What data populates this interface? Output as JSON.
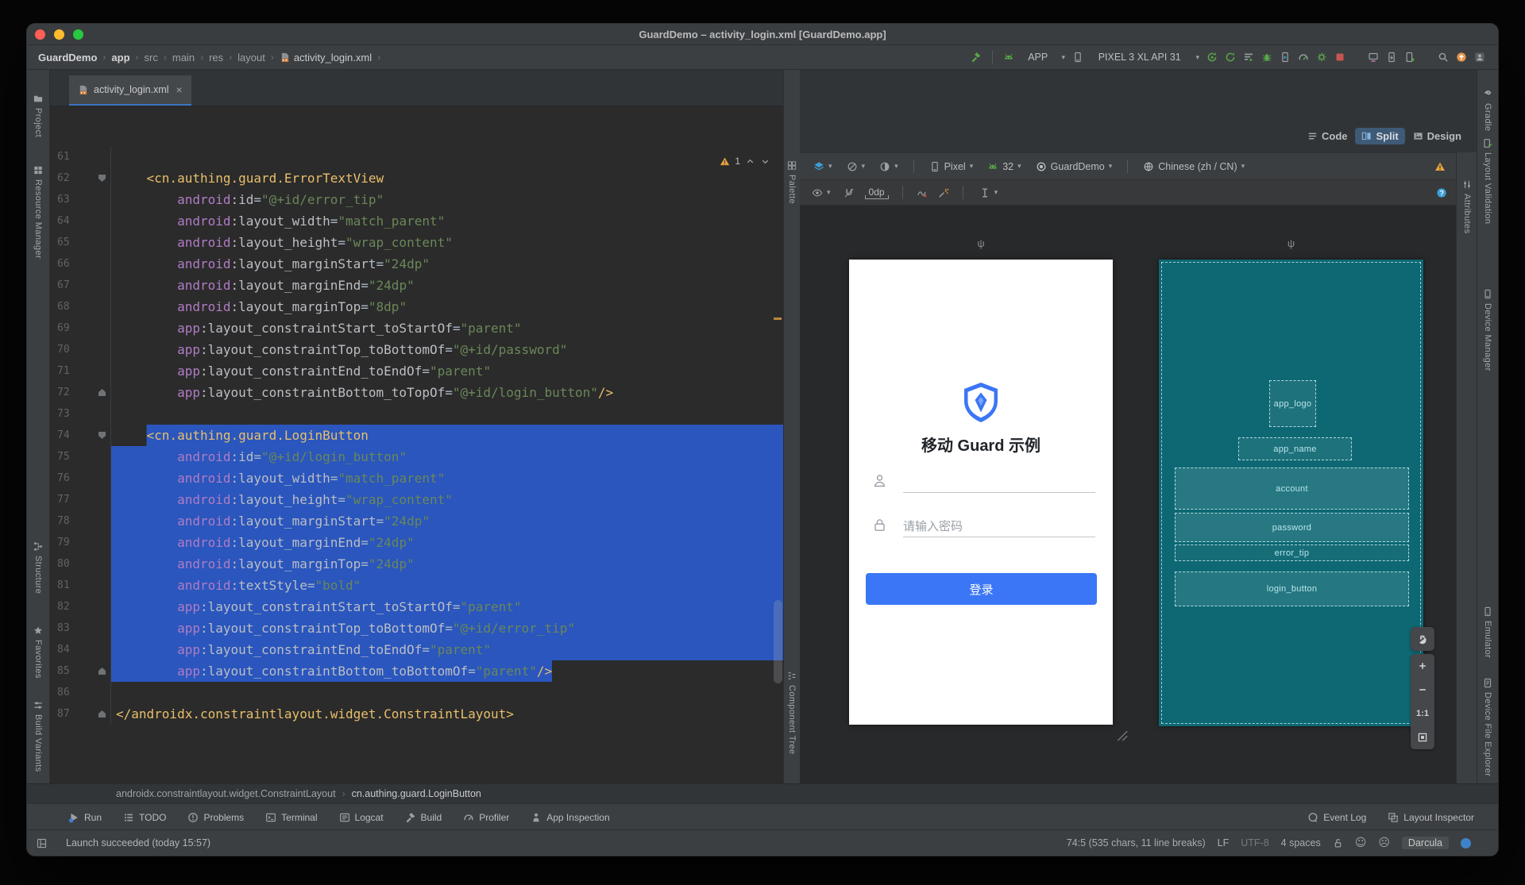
{
  "window_title": "GuardDemo – activity_login.xml [GuardDemo.app]",
  "breadcrumbs": {
    "items": [
      "GuardDemo",
      "app",
      "src",
      "main",
      "res",
      "layout",
      "activity_login.xml"
    ],
    "bold_items": [
      "GuardDemo",
      "app"
    ],
    "file_icon": "xml-file-icon"
  },
  "main_toolbar": {
    "build_icon": "hammer-icon",
    "run_config": {
      "icon": "android-head-icon",
      "label": "APP",
      "caret": "▾"
    },
    "device_select": {
      "icon": "device-phone-icon",
      "label": "PIXEL 3 XL API 31",
      "caret": "▾"
    },
    "action_icons": [
      "apply-changes-icon",
      "apply-code-changes-icon",
      "profiler-sessions-icon",
      "debug-icon",
      "attach-debugger-icon",
      "profile-app-icon",
      "coverage-icon",
      "stop-icon"
    ],
    "utility_icons": [
      "device-mirror-icon",
      "device-manager-icon",
      "virtual-device-icon"
    ],
    "end_icons": [
      "search-icon",
      "ide-update-icon",
      "avatar-icon"
    ]
  },
  "left_strip": [
    {
      "label": "Project",
      "icon": "project-icon"
    },
    {
      "label": "Resource Manager",
      "icon": "resource-manager-icon"
    },
    {
      "label": "Structure",
      "icon": "structure-icon"
    },
    {
      "label": "Favorites",
      "icon": "favorites-icon"
    },
    {
      "label": "Build Variants",
      "icon": "build-variants-icon"
    }
  ],
  "right_strip": [
    {
      "label": "Gradle",
      "icon": "gradle-icon"
    },
    {
      "label": "Layout Validation",
      "icon": "layout-validation-icon"
    },
    {
      "label": "Device Manager",
      "icon": "device-manager-strip-icon"
    },
    {
      "label": "Emulator",
      "icon": "emulator-icon"
    },
    {
      "label": "Device File Explorer",
      "icon": "device-file-explorer-icon"
    }
  ],
  "mid_strip": {
    "palette": {
      "label": "Palette",
      "icon": "palette-icon"
    },
    "component_tree": {
      "label": "Component Tree",
      "icon": "component-tree-icon"
    }
  },
  "attributes_tab": {
    "label": "Attributes",
    "icon": "attributes-icon"
  },
  "view_modes": {
    "options": [
      {
        "label": "Code",
        "icon": "code-view-icon",
        "active": false
      },
      {
        "label": "Split",
        "icon": "split-view-icon",
        "active": true
      },
      {
        "label": "Design",
        "icon": "design-view-icon",
        "active": false
      }
    ]
  },
  "editor": {
    "tab_label": "activity_login.xml",
    "warning_count": "1",
    "lines": [
      {
        "n": 61,
        "ind": 0,
        "tok": []
      },
      {
        "n": 62,
        "ind": 4,
        "fold": "down",
        "tok": [
          [
            "t",
            "<cn.authing.guard.ErrorTextView"
          ]
        ]
      },
      {
        "n": 63,
        "ind": 8,
        "tok": [
          [
            "n",
            "android"
          ],
          [
            "a",
            ":id"
          ],
          [
            "q",
            "="
          ],
          [
            "v",
            "\"@+id/error_tip\""
          ]
        ]
      },
      {
        "n": 64,
        "ind": 8,
        "tok": [
          [
            "n",
            "android"
          ],
          [
            "a",
            ":layout_width"
          ],
          [
            "q",
            "="
          ],
          [
            "v",
            "\"match_parent\""
          ]
        ]
      },
      {
        "n": 65,
        "ind": 8,
        "tok": [
          [
            "n",
            "android"
          ],
          [
            "a",
            ":layout_height"
          ],
          [
            "q",
            "="
          ],
          [
            "v",
            "\"wrap_content\""
          ]
        ]
      },
      {
        "n": 66,
        "ind": 8,
        "tok": [
          [
            "n",
            "android"
          ],
          [
            "a",
            ":layout_marginStart"
          ],
          [
            "q",
            "="
          ],
          [
            "v",
            "\"24dp\""
          ]
        ]
      },
      {
        "n": 67,
        "ind": 8,
        "tok": [
          [
            "n",
            "android"
          ],
          [
            "a",
            ":layout_marginEnd"
          ],
          [
            "q",
            "="
          ],
          [
            "v",
            "\"24dp\""
          ]
        ]
      },
      {
        "n": 68,
        "ind": 8,
        "tok": [
          [
            "n",
            "android"
          ],
          [
            "a",
            ":layout_marginTop"
          ],
          [
            "q",
            "="
          ],
          [
            "v",
            "\"8dp\""
          ]
        ]
      },
      {
        "n": 69,
        "ind": 8,
        "tok": [
          [
            "n",
            "app"
          ],
          [
            "a",
            ":layout_constraintStart_toStartOf"
          ],
          [
            "q",
            "="
          ],
          [
            "v",
            "\"parent\""
          ]
        ]
      },
      {
        "n": 70,
        "ind": 8,
        "tok": [
          [
            "n",
            "app"
          ],
          [
            "a",
            ":layout_constraintTop_toBottomOf"
          ],
          [
            "q",
            "="
          ],
          [
            "v",
            "\"@+id/password\""
          ]
        ]
      },
      {
        "n": 71,
        "ind": 8,
        "tok": [
          [
            "n",
            "app"
          ],
          [
            "a",
            ":layout_constraintEnd_toEndOf"
          ],
          [
            "q",
            "="
          ],
          [
            "v",
            "\"parent\""
          ]
        ]
      },
      {
        "n": 72,
        "ind": 8,
        "fold": "up",
        "tok": [
          [
            "n",
            "app"
          ],
          [
            "a",
            ":layout_constraintBottom_toTopOf"
          ],
          [
            "q",
            "="
          ],
          [
            "v",
            "\"@+id/login_button\""
          ],
          [
            "t",
            "/>"
          ]
        ]
      },
      {
        "n": 73,
        "ind": 0,
        "tok": []
      },
      {
        "n": 74,
        "ind": 4,
        "fold": "down",
        "sel": "from",
        "tok": [
          [
            "t",
            "<cn.authing.guard.LoginButton"
          ]
        ]
      },
      {
        "n": 75,
        "ind": 8,
        "sel": "full",
        "tok": [
          [
            "n",
            "android"
          ],
          [
            "a",
            ":id"
          ],
          [
            "q",
            "="
          ],
          [
            "v",
            "\"@+id/login_button\""
          ]
        ]
      },
      {
        "n": 76,
        "ind": 8,
        "sel": "full",
        "tok": [
          [
            "n",
            "android"
          ],
          [
            "a",
            ":layout_width"
          ],
          [
            "q",
            "="
          ],
          [
            "v",
            "\"match_parent\""
          ]
        ]
      },
      {
        "n": 77,
        "ind": 8,
        "sel": "full",
        "tok": [
          [
            "n",
            "android"
          ],
          [
            "a",
            ":layout_height"
          ],
          [
            "q",
            "="
          ],
          [
            "v",
            "\"wrap_content\""
          ]
        ]
      },
      {
        "n": 78,
        "ind": 8,
        "sel": "full",
        "tok": [
          [
            "n",
            "android"
          ],
          [
            "a",
            ":layout_marginStart"
          ],
          [
            "q",
            "="
          ],
          [
            "v",
            "\"24dp\""
          ]
        ]
      },
      {
        "n": 79,
        "ind": 8,
        "sel": "full",
        "tok": [
          [
            "n",
            "android"
          ],
          [
            "a",
            ":layout_marginEnd"
          ],
          [
            "q",
            "="
          ],
          [
            "v",
            "\"24dp\""
          ]
        ]
      },
      {
        "n": 80,
        "ind": 8,
        "sel": "full",
        "tok": [
          [
            "n",
            "android"
          ],
          [
            "a",
            ":layout_marginTop"
          ],
          [
            "q",
            "="
          ],
          [
            "v",
            "\"24dp\""
          ]
        ]
      },
      {
        "n": 81,
        "ind": 8,
        "sel": "full",
        "tok": [
          [
            "n",
            "android"
          ],
          [
            "a",
            ":textStyle"
          ],
          [
            "q",
            "="
          ],
          [
            "v",
            "\"bold\""
          ]
        ]
      },
      {
        "n": 82,
        "ind": 8,
        "sel": "full",
        "tok": [
          [
            "n",
            "app"
          ],
          [
            "a",
            ":layout_constraintStart_toStartOf"
          ],
          [
            "q",
            "="
          ],
          [
            "v",
            "\"parent\""
          ]
        ]
      },
      {
        "n": 83,
        "ind": 8,
        "sel": "full",
        "tok": [
          [
            "n",
            "app"
          ],
          [
            "a",
            ":layout_constraintTop_toBottomOf"
          ],
          [
            "q",
            "="
          ],
          [
            "v",
            "\"@+id/error_tip\""
          ]
        ]
      },
      {
        "n": 84,
        "ind": 8,
        "sel": "full",
        "tok": [
          [
            "n",
            "app"
          ],
          [
            "a",
            ":layout_constraintEnd_toEndOf"
          ],
          [
            "q",
            "="
          ],
          [
            "v",
            "\"parent\""
          ]
        ]
      },
      {
        "n": 85,
        "ind": 8,
        "fold": "up",
        "sel": "to",
        "tok": [
          [
            "n",
            "app"
          ],
          [
            "a",
            ":layout_constraintBottom_toBottomOf"
          ],
          [
            "q",
            "="
          ],
          [
            "v",
            "\"parent\""
          ],
          [
            "t",
            "/>"
          ]
        ]
      },
      {
        "n": 86,
        "ind": 0,
        "tok": []
      },
      {
        "n": 87,
        "ind": 0,
        "fold": "up",
        "tok": [
          [
            "t",
            "</androidx.constraintlayout.widget.ConstraintLayout>"
          ]
        ]
      }
    ]
  },
  "design_toolbar": {
    "surface_icons": [
      "design-surface-icon",
      "orientation-icon",
      "night-mode-icon"
    ],
    "device": {
      "icon": "device-phone-icon",
      "label": "Pixel"
    },
    "api": {
      "icon": "android-head-icon",
      "label": "32"
    },
    "theme": {
      "icon": "theme-icon",
      "label": "GuardDemo"
    },
    "locale": {
      "icon": "globe-icon",
      "label": "Chinese (zh / CN)"
    },
    "warning_icon": "warning-icon",
    "row2": {
      "view_options_icon": "eye-icon",
      "autoconnect_icon": "magnet-off-icon",
      "default_margin": "0dp",
      "clear_constraints_icon": "clear-constraints-icon",
      "infer_constraints_icon": "magic-wand-icon",
      "pack_icon": "pack-icon",
      "help_icon": "help-icon"
    }
  },
  "preview": {
    "device_header_glyph": "ψ",
    "logo_icon": "shield-logo-icon",
    "app_title": "移动 Guard 示例",
    "account_icon": "person-icon",
    "password_icon": "lock-icon",
    "password_placeholder": "请输入密码",
    "login_button": "登录",
    "accent_color": "#3b76f6"
  },
  "blueprint": {
    "background_color": "#0d6873",
    "ids": [
      "app_logo",
      "app_name",
      "account",
      "password",
      "error_tip",
      "login_button"
    ]
  },
  "zoom_controls": {
    "icons": [
      "pan-hand-icon",
      "zoom-in-icon",
      "zoom-out-icon"
    ],
    "ratio_label": "1:1",
    "fit_icon": "zoom-fit-icon"
  },
  "component_breadcrumb": [
    "androidx.constraintlayout.widget.ConstraintLayout",
    "cn.authing.guard.LoginButton"
  ],
  "tool_buttons_left": [
    {
      "label": "Run",
      "icon": "run-icon"
    },
    {
      "label": "TODO",
      "icon": "todo-icon"
    },
    {
      "label": "Problems",
      "icon": "problems-icon"
    },
    {
      "label": "Terminal",
      "icon": "terminal-icon"
    },
    {
      "label": "Logcat",
      "icon": "logcat-icon"
    },
    {
      "label": "Build",
      "icon": "build-hammer-icon"
    },
    {
      "label": "Profiler",
      "icon": "profiler-icon"
    },
    {
      "label": "App Inspection",
      "icon": "app-inspection-icon"
    }
  ],
  "tool_buttons_right": [
    {
      "label": "Event Log",
      "icon": "event-log-icon"
    },
    {
      "label": "Layout Inspector",
      "icon": "layout-inspector-icon"
    }
  ],
  "status_bar": {
    "window_icon": "window-layout-icon",
    "message": "Launch succeeded (today 15:57)",
    "caret_position": "74:5 (535 chars, 11 line breaks)",
    "line_separator": "LF",
    "encoding": "UTF-8",
    "indent": "4 spaces",
    "lock_icon": "lock-open-icon",
    "smile_icon": "smile-icon",
    "frown_icon": "frown-icon",
    "theme": "Darcula",
    "theme_dot_color": "#3e83c9"
  }
}
